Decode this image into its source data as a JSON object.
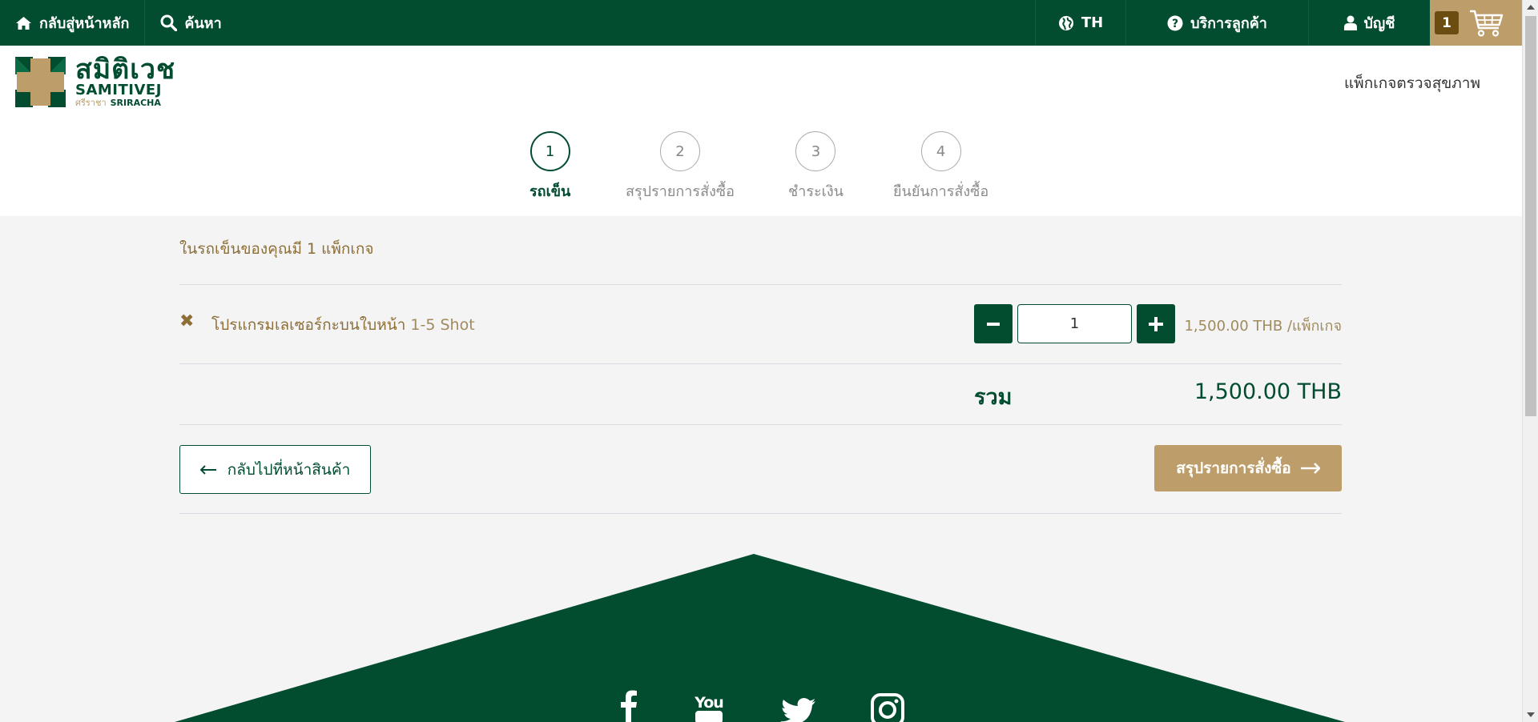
{
  "topbar": {
    "home_label": "กลับสู่หน้าหลัก",
    "search_label": "ค้นหา",
    "lang_label": "TH",
    "customer_service_label": "บริการลูกค้า",
    "account_label": "บัญชี",
    "cart_count": "1"
  },
  "header": {
    "logo_th": "สมิติเวช",
    "logo_en": "SAMITIVEJ",
    "logo_sub_th": "ศรีราชา",
    "logo_sub_en": "SRIRACHA",
    "nav_link": "แพ็กเกจตรวจสุขภาพ"
  },
  "steps": [
    {
      "num": "1",
      "label": "รถเข็น",
      "active": true
    },
    {
      "num": "2",
      "label": "สรุปรายการสั่งซื้อ",
      "active": false
    },
    {
      "num": "3",
      "label": "ชำระเงิน",
      "active": false
    },
    {
      "num": "4",
      "label": "ยืนยันการสั่งซื้อ",
      "active": false
    }
  ],
  "cart": {
    "count_text": "ในรถเข็นของคุณมี 1 แพ็กเกจ",
    "item_name": "โปรแกรมเลเซอร์กะบนใบหน้า",
    "item_suffix": "1-5 Shot",
    "quantity": "1",
    "unit_price": "1,500.00 THB /แพ็กเกจ",
    "total_label": "รวม",
    "total_value": "1,500.00 THB",
    "back_label": "กลับไปที่หน้าสินค้า",
    "next_label": "สรุปรายการสั่งซื้อ"
  },
  "colors": {
    "brand_green": "#024c30",
    "brand_gold": "#bd9e6a",
    "text_gold": "#8c6e36"
  }
}
